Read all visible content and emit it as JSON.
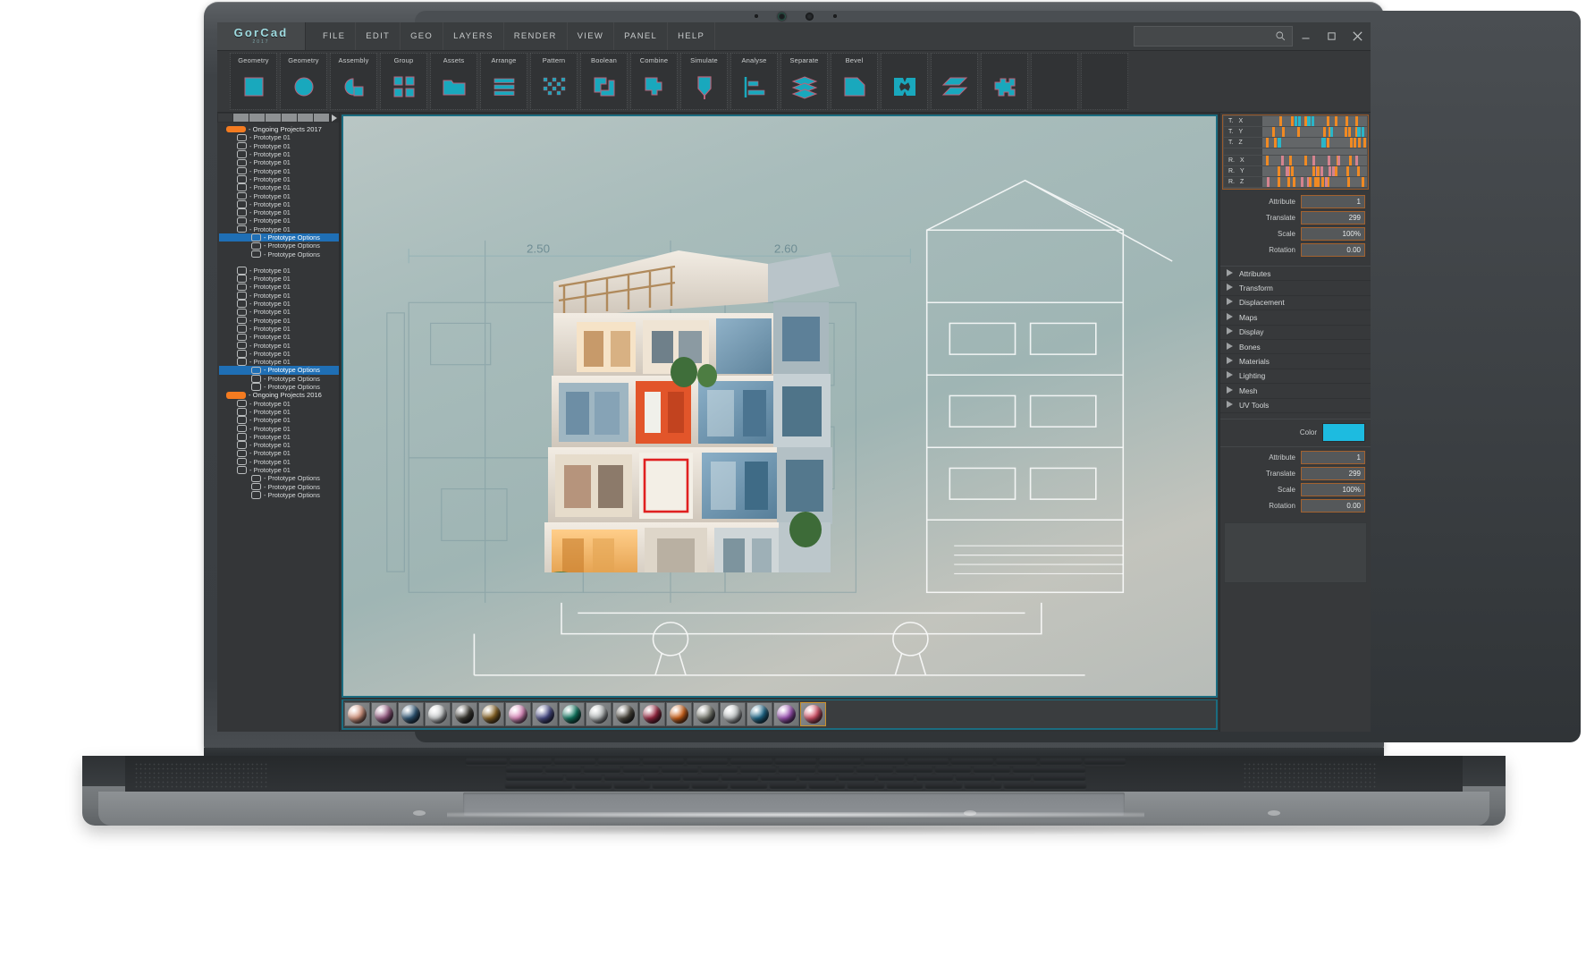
{
  "app": {
    "logo_main": "GorCad",
    "logo_sub": "2017",
    "menu": [
      "File",
      "Edit",
      "Geo",
      "Layers",
      "Render",
      "View",
      "Panel",
      "Help"
    ],
    "search_placeholder": "",
    "window_controls": [
      {
        "name": "search-icon",
        "glyph": "search"
      },
      {
        "name": "minimize-button",
        "glyph": "minimize"
      },
      {
        "name": "maximize-button",
        "glyph": "maximize"
      },
      {
        "name": "close-button",
        "glyph": "close"
      }
    ]
  },
  "toolbar": {
    "tools": [
      {
        "label": "Geometry",
        "icon": "square-icon"
      },
      {
        "label": "Geometry",
        "icon": "circle-icon"
      },
      {
        "label": "Assembly",
        "icon": "pie-square-icon"
      },
      {
        "label": "Group",
        "icon": "four-squares-icon"
      },
      {
        "label": "Assets",
        "icon": "folder-icon"
      },
      {
        "label": "Arrange",
        "icon": "stacked-bars-icon"
      },
      {
        "label": "Pattern",
        "icon": "checker-icon"
      },
      {
        "label": "Boolean",
        "icon": "boolean-icon"
      },
      {
        "label": "Combine",
        "icon": "combine-icon"
      },
      {
        "label": "Simulate",
        "icon": "shield-arrow-icon"
      },
      {
        "label": "Analyse",
        "icon": "bar-axis-icon"
      },
      {
        "label": "Separate",
        "icon": "layers-icon"
      },
      {
        "label": "Bevel",
        "icon": "bevel-icon"
      },
      {
        "label": "",
        "icon": "diamond-quad-icon"
      },
      {
        "label": "",
        "icon": "parallelogram-stack-icon"
      },
      {
        "label": "",
        "icon": "puzzle-icon"
      },
      {
        "label": "",
        "icon": "blank-icon"
      },
      {
        "label": "",
        "icon": "blank-icon"
      }
    ]
  },
  "sidebar": {
    "tabs": [
      "",
      "",
      "",
      "",
      "",
      "",
      "",
      ""
    ],
    "tree": [
      {
        "type": "group",
        "label": "- Ongoing Projects 2017",
        "swatch": "#f47b20"
      },
      {
        "type": "item",
        "label": "- Prototype 01"
      },
      {
        "type": "item",
        "label": "- Prototype 01"
      },
      {
        "type": "item",
        "label": "- Prototype 01"
      },
      {
        "type": "item",
        "label": "- Prototype 01"
      },
      {
        "type": "item",
        "label": "- Prototype 01"
      },
      {
        "type": "item",
        "label": "- Prototype 01"
      },
      {
        "type": "item",
        "label": "- Prototype 01"
      },
      {
        "type": "item",
        "label": "- Prototype 01"
      },
      {
        "type": "item",
        "label": "- Prototype 01"
      },
      {
        "type": "item",
        "label": "- Prototype 01"
      },
      {
        "type": "item",
        "label": "- Prototype 01"
      },
      {
        "type": "item",
        "label": "- Prototype 01"
      },
      {
        "type": "sub",
        "label": "- Prototype Options",
        "selected": true
      },
      {
        "type": "sub",
        "label": "- Prototype Options"
      },
      {
        "type": "sub",
        "label": "- Prototype Options"
      },
      {
        "type": "gap"
      },
      {
        "type": "item",
        "label": "- Prototype 01"
      },
      {
        "type": "item",
        "label": "- Prototype 01"
      },
      {
        "type": "item",
        "label": "- Prototype 01"
      },
      {
        "type": "item",
        "label": "- Prototype 01"
      },
      {
        "type": "item",
        "label": "- Prototype 01"
      },
      {
        "type": "item",
        "label": "- Prototype 01"
      },
      {
        "type": "item",
        "label": "- Prototype 01"
      },
      {
        "type": "item",
        "label": "- Prototype 01"
      },
      {
        "type": "item",
        "label": "- Prototype 01"
      },
      {
        "type": "item",
        "label": "- Prototype 01"
      },
      {
        "type": "item",
        "label": "- Prototype 01"
      },
      {
        "type": "item",
        "label": "- Prototype 01"
      },
      {
        "type": "sub",
        "label": "- Prototype Options",
        "selected": true
      },
      {
        "type": "sub",
        "label": "- Prototype Options"
      },
      {
        "type": "sub",
        "label": "- Prototype Options"
      },
      {
        "type": "group",
        "label": "- Ongoing Projects 2016",
        "swatch": "#f47b20"
      },
      {
        "type": "item",
        "label": "- Prototype 01"
      },
      {
        "type": "item",
        "label": "- Prototype 01"
      },
      {
        "type": "item",
        "label": "- Prototype 01"
      },
      {
        "type": "item",
        "label": "- Prototype 01"
      },
      {
        "type": "item",
        "label": "- Prototype 01"
      },
      {
        "type": "item",
        "label": "- Prototype 01"
      },
      {
        "type": "item",
        "label": "- Prototype 01"
      },
      {
        "type": "item",
        "label": "- Prototype 01"
      },
      {
        "type": "item",
        "label": "- Prototype 01"
      },
      {
        "type": "sub",
        "label": "- Prototype Options"
      },
      {
        "type": "sub",
        "label": "- Prototype Options"
      },
      {
        "type": "sub",
        "label": "- Prototype Options"
      }
    ]
  },
  "viewport": {
    "blueprint_dimensions": [
      "2.50",
      "2.60"
    ],
    "accent_border": "#1b6c80"
  },
  "materials": {
    "swatches": [
      {
        "name": "material-salmon",
        "color": "#d99a84"
      },
      {
        "name": "material-mauve",
        "color": "#9a5f86"
      },
      {
        "name": "material-navy",
        "color": "#2f5878"
      },
      {
        "name": "material-white",
        "color": "#cfd2d3"
      },
      {
        "name": "material-dark-chrome",
        "color": "#3c3a33"
      },
      {
        "name": "material-bronze",
        "color": "#8a6524"
      },
      {
        "name": "material-pink",
        "color": "#e08ec0"
      },
      {
        "name": "material-indigo",
        "color": "#4b4e8a"
      },
      {
        "name": "material-teal",
        "color": "#117a63"
      },
      {
        "name": "material-silver",
        "color": "#b9bdbe"
      },
      {
        "name": "material-olive-dark",
        "color": "#4a463c"
      },
      {
        "name": "material-crimson",
        "color": "#9c2842"
      },
      {
        "name": "material-orange",
        "color": "#d2641a"
      },
      {
        "name": "material-grey-green",
        "color": "#7f8177"
      },
      {
        "name": "material-light-grey",
        "color": "#c2c6c7"
      },
      {
        "name": "material-steel-blue",
        "color": "#1f6a8c"
      },
      {
        "name": "material-violet",
        "color": "#a055b8"
      },
      {
        "name": "material-rose",
        "color": "#d6546a",
        "active": true
      }
    ]
  },
  "inspector": {
    "timeline": {
      "rows": [
        {
          "label_a": "T.",
          "label_b": "X"
        },
        {
          "label_a": "T.",
          "label_b": "Y"
        },
        {
          "label_a": "T.",
          "label_b": "Z"
        },
        {
          "label_a": "R.",
          "label_b": "X"
        },
        {
          "label_a": "R.",
          "label_b": "Y"
        },
        {
          "label_a": "R.",
          "label_b": "Z"
        }
      ]
    },
    "fields_top": [
      {
        "label": "Attribute",
        "value": "1"
      },
      {
        "label": "Translate",
        "value": "299"
      },
      {
        "label": "Scale",
        "value": "100%"
      },
      {
        "label": "Rotation",
        "value": "0.00"
      }
    ],
    "sections": [
      "Attributes",
      "Transform",
      "Displacement",
      "Maps",
      "Display",
      "Bones",
      "Materials",
      "Lighting",
      "Mesh",
      "UV Tools"
    ],
    "color": {
      "label": "Color",
      "value": "#1dbbe0"
    },
    "fields_bottom": [
      {
        "label": "Attribute",
        "value": "1"
      },
      {
        "label": "Translate",
        "value": "299"
      },
      {
        "label": "Scale",
        "value": "100%"
      },
      {
        "label": "Rotation",
        "value": "0.00"
      }
    ]
  }
}
